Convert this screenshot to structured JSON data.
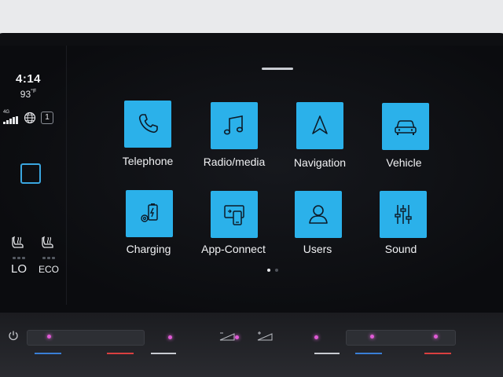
{
  "status": {
    "time": "4:14",
    "temperature": "93",
    "temperature_unit": "°F",
    "network": "4G",
    "notification_count": "1"
  },
  "seats": {
    "left_label": "LO",
    "right_label": "ECO"
  },
  "apps": [
    {
      "label": "Telephone",
      "icon": "phone-icon"
    },
    {
      "label": "Radio/media",
      "icon": "music-note-icon"
    },
    {
      "label": "Navigation",
      "icon": "navigation-arrow-icon"
    },
    {
      "label": "Vehicle",
      "icon": "car-icon"
    },
    {
      "label": "Charging",
      "icon": "battery-charging-icon"
    },
    {
      "label": "App-Connect",
      "icon": "phone-connect-icon"
    },
    {
      "label": "Users",
      "icon": "user-icon"
    },
    {
      "label": "Sound",
      "icon": "equalizer-icon"
    }
  ],
  "pagination": {
    "current": 1,
    "total": 2
  },
  "colors": {
    "tile": "#2bb1ea",
    "accent": "#3aa6e0",
    "led": "#e05ad6",
    "underline_blue": "#3a7fd6",
    "underline_red": "#d94040"
  }
}
